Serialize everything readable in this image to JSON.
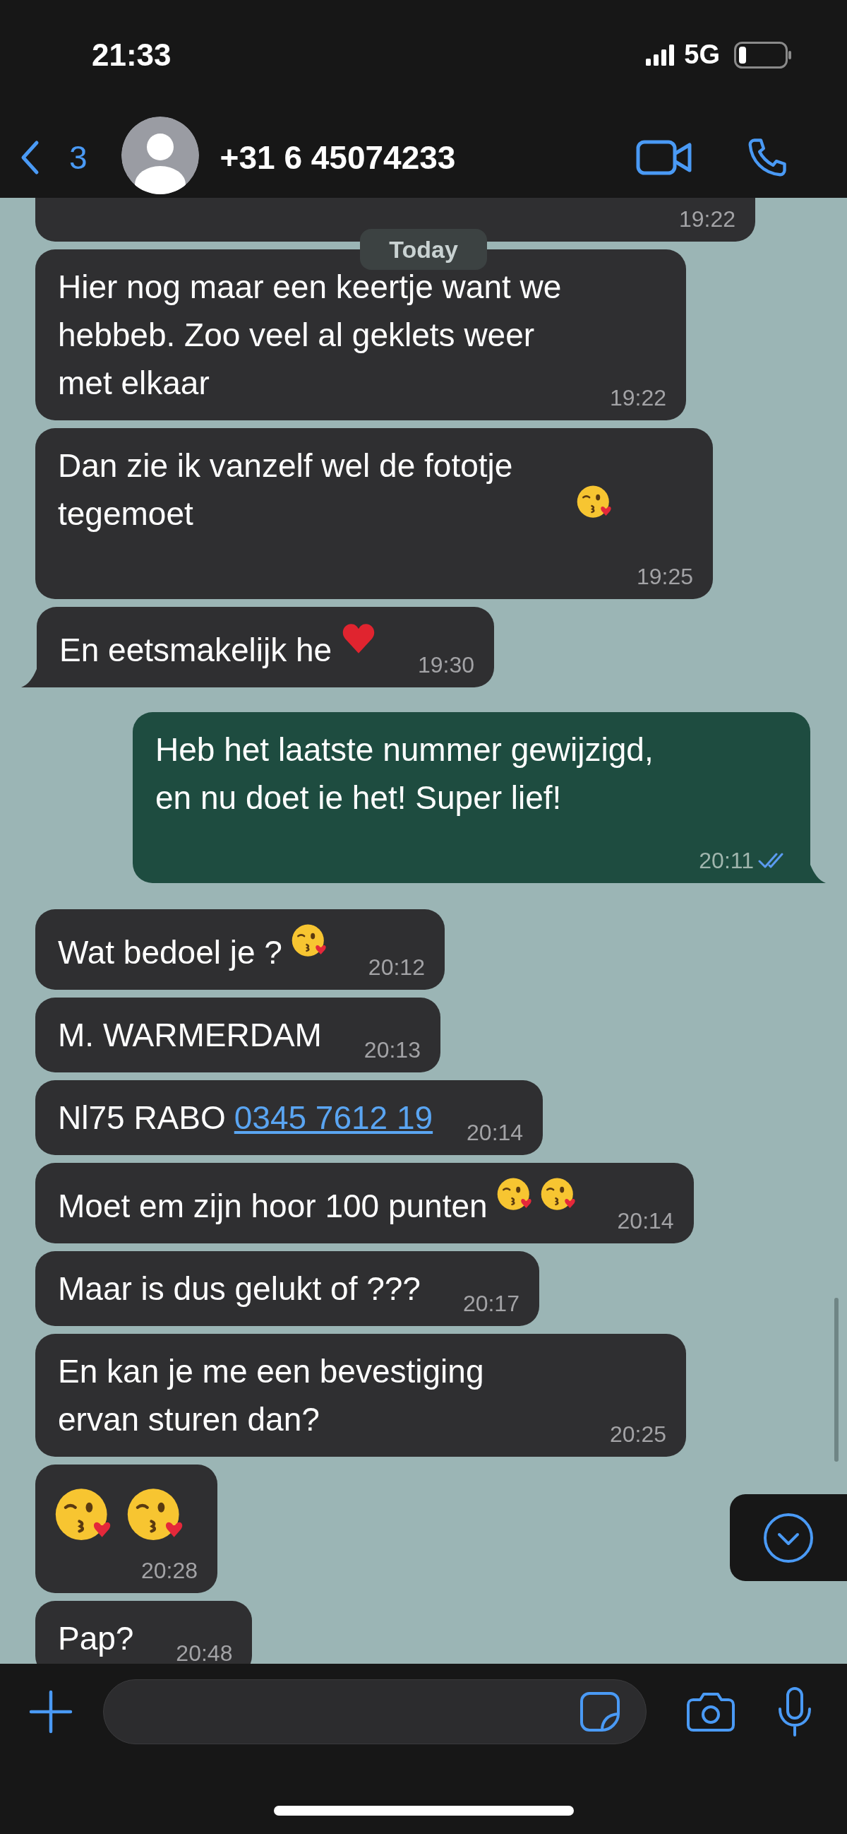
{
  "status_bar": {
    "time": "21:33",
    "network": "5G"
  },
  "header": {
    "back_count": "3",
    "contact": "+31 6 45074233"
  },
  "date_pill": "Today",
  "messages": [
    {
      "kind": "incoming",
      "tail": false,
      "time": "19:22"
    },
    {
      "kind": "incoming",
      "tail": false,
      "parts": [
        {
          "kind": "text",
          "text": "Hier nog maar een keertje want we hebbeb. Zoo veel al geklets weer met elkaar"
        }
      ],
      "time": "19:22"
    },
    {
      "kind": "incoming",
      "tail": false,
      "parts": [
        {
          "kind": "text",
          "text": "Dan zie ik vanzelf wel de fototje tegemoet"
        },
        {
          "kind": "kiss_emoji"
        }
      ],
      "time": "19:25"
    },
    {
      "kind": "incoming",
      "tail": true,
      "parts": [
        {
          "kind": "text",
          "text": "En eetsmakelijk he"
        },
        {
          "kind": "heart_emoji"
        }
      ],
      "time": "19:30"
    },
    {
      "kind": "outgoing",
      "tail": true,
      "read": true,
      "parts": [
        {
          "kind": "text",
          "text": "Heb het laatste nummer gewijzigd, en nu doet ie het! Super lief!"
        }
      ],
      "time": "20:11"
    },
    {
      "kind": "incoming",
      "tail": false,
      "parts": [
        {
          "kind": "text",
          "text": "Wat bedoel je ?"
        },
        {
          "kind": "kiss_emoji"
        }
      ],
      "time": "20:12"
    },
    {
      "kind": "incoming",
      "tail": false,
      "parts": [
        {
          "kind": "text",
          "text": "M. WARMERDAM"
        }
      ],
      "time": "20:13"
    },
    {
      "kind": "incoming",
      "tail": false,
      "parts": [
        {
          "kind": "text",
          "text": "Nl75 RABO"
        },
        {
          "kind": "link",
          "text": "0345 7612 19"
        }
      ],
      "time": "20:14"
    },
    {
      "kind": "incoming",
      "tail": false,
      "parts": [
        {
          "kind": "text",
          "text": "Moet em zijn hoor 100 punten"
        },
        {
          "kind": "kiss_emoji"
        },
        {
          "kind": "kiss_emoji"
        }
      ],
      "time": "20:14"
    },
    {
      "kind": "incoming",
      "tail": false,
      "parts": [
        {
          "kind": "text",
          "text": "Maar is dus gelukt of ???"
        }
      ],
      "time": "20:17"
    },
    {
      "kind": "incoming",
      "tail": false,
      "parts": [
        {
          "kind": "text",
          "text": "En kan je me een bevestiging ervan sturen dan?"
        }
      ],
      "time": "20:25"
    },
    {
      "kind": "incoming",
      "tail": false,
      "parts": [
        {
          "kind": "kiss_emoji"
        },
        {
          "kind": "kiss_emoji"
        }
      ],
      "time": "20:28"
    },
    {
      "kind": "incoming",
      "tail": false,
      "parts": [
        {
          "kind": "text",
          "text": "Pap?"
        }
      ],
      "time": "20:48"
    }
  ]
}
